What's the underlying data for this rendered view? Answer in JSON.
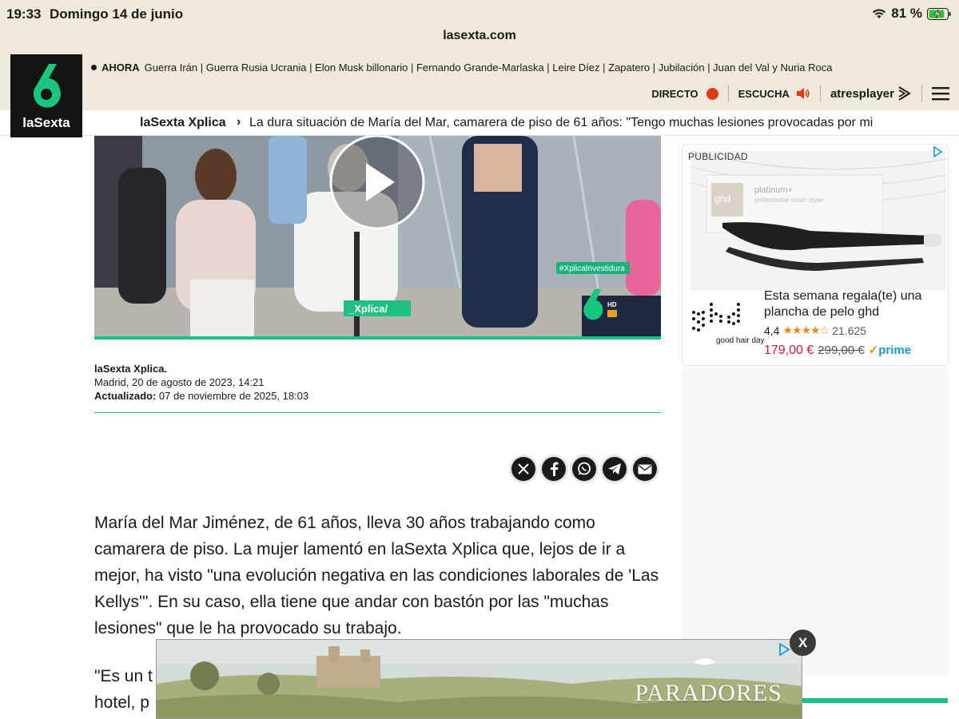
{
  "status_bar": {
    "time": "19:33",
    "date": "Domingo 14 de junio",
    "battery": "81 %"
  },
  "browser": {
    "url": "lasexta.com"
  },
  "site": {
    "logo_text": "laSexta",
    "ticker": {
      "label": "AHORA",
      "text": "Guerra Irán | Guerra Rusia Ucrania | Elon Musk billonario | Fernando Grande-Marlaska | Leire Díez | Zapatero | Jubilación | Juan del Val y Nuria Roca"
    },
    "tools": {
      "directo": "DIRECTO",
      "escucha": "ESCUCHA",
      "atresplayer": "atresplayer"
    },
    "subnav": {
      "section": "laSexta Xplica",
      "headline": "La dura situación de María del Mar, camarera de piso de 61 años: \"Tengo muchas lesiones provocadas por mi"
    }
  },
  "video": {
    "hashtag": "#XplicaInvestidura",
    "program_tag": "_Xplica/",
    "channel_badge": "HD"
  },
  "article": {
    "author": "laSexta Xplica.",
    "place_date": "Madrid, 20 de agosto de 2023, 14:21",
    "updated_label": "Actualizado:",
    "updated_date": "07 de noviembre de 2025, 18:03",
    "paragraph1": "María del Mar Jiménez, de 61 años, lleva 30 años trabajando como camarera de piso. La mujer lamentó en laSexta Xplica que, lejos de ir a mejor, ha visto \"una evolución negativa en las condiciones laborales de 'Las Kellys'\". En su caso, ella tiene que andar con bastón por las \"muchas lesiones\" que le ha provocado su trabajo.",
    "paragraph2_visible_start": "\"Es un t",
    "paragraph2_line2_start": "hotel, p"
  },
  "side_ad": {
    "label": "PUBLICIDAD",
    "product_text": "platinum+",
    "product_sub": "professional smart styler",
    "box_brand": "ghd",
    "title": "Esta semana regala(te) una plancha de pelo ghd",
    "rating": "4,4",
    "rating_value": 4.4,
    "reviews": "21.625",
    "price": "179,00 €",
    "old_price": "299,00 €",
    "prime": "prime",
    "brand": "ghd",
    "tagline": "good hair day"
  },
  "bottom_ad": {
    "brand": "PARADORES",
    "close": "X"
  }
}
